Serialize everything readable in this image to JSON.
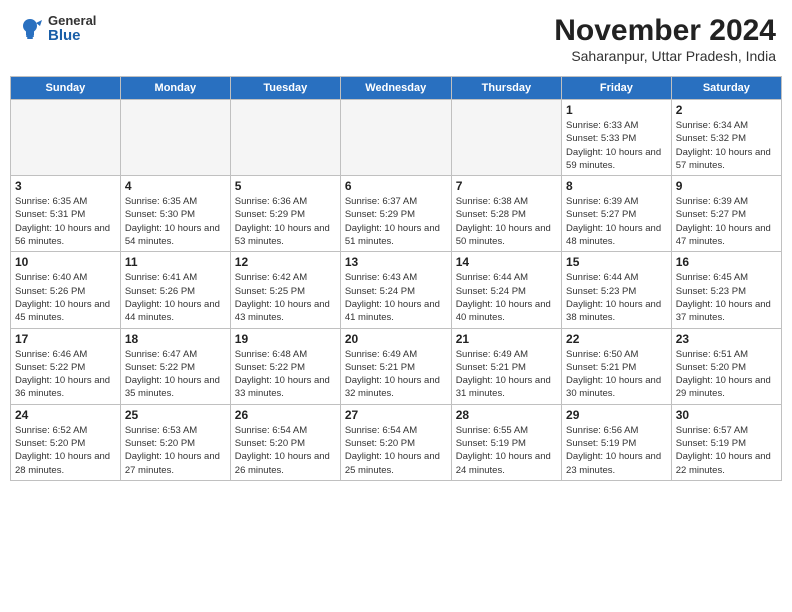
{
  "header": {
    "logo_general": "General",
    "logo_blue": "Blue",
    "month_title": "November 2024",
    "subtitle": "Saharanpur, Uttar Pradesh, India"
  },
  "weekdays": [
    "Sunday",
    "Monday",
    "Tuesday",
    "Wednesday",
    "Thursday",
    "Friday",
    "Saturday"
  ],
  "weeks": [
    [
      {
        "day": "",
        "info": ""
      },
      {
        "day": "",
        "info": ""
      },
      {
        "day": "",
        "info": ""
      },
      {
        "day": "",
        "info": ""
      },
      {
        "day": "",
        "info": ""
      },
      {
        "day": "1",
        "info": "Sunrise: 6:33 AM\nSunset: 5:33 PM\nDaylight: 10 hours and 59 minutes."
      },
      {
        "day": "2",
        "info": "Sunrise: 6:34 AM\nSunset: 5:32 PM\nDaylight: 10 hours and 57 minutes."
      }
    ],
    [
      {
        "day": "3",
        "info": "Sunrise: 6:35 AM\nSunset: 5:31 PM\nDaylight: 10 hours and 56 minutes."
      },
      {
        "day": "4",
        "info": "Sunrise: 6:35 AM\nSunset: 5:30 PM\nDaylight: 10 hours and 54 minutes."
      },
      {
        "day": "5",
        "info": "Sunrise: 6:36 AM\nSunset: 5:29 PM\nDaylight: 10 hours and 53 minutes."
      },
      {
        "day": "6",
        "info": "Sunrise: 6:37 AM\nSunset: 5:29 PM\nDaylight: 10 hours and 51 minutes."
      },
      {
        "day": "7",
        "info": "Sunrise: 6:38 AM\nSunset: 5:28 PM\nDaylight: 10 hours and 50 minutes."
      },
      {
        "day": "8",
        "info": "Sunrise: 6:39 AM\nSunset: 5:27 PM\nDaylight: 10 hours and 48 minutes."
      },
      {
        "day": "9",
        "info": "Sunrise: 6:39 AM\nSunset: 5:27 PM\nDaylight: 10 hours and 47 minutes."
      }
    ],
    [
      {
        "day": "10",
        "info": "Sunrise: 6:40 AM\nSunset: 5:26 PM\nDaylight: 10 hours and 45 minutes."
      },
      {
        "day": "11",
        "info": "Sunrise: 6:41 AM\nSunset: 5:26 PM\nDaylight: 10 hours and 44 minutes."
      },
      {
        "day": "12",
        "info": "Sunrise: 6:42 AM\nSunset: 5:25 PM\nDaylight: 10 hours and 43 minutes."
      },
      {
        "day": "13",
        "info": "Sunrise: 6:43 AM\nSunset: 5:24 PM\nDaylight: 10 hours and 41 minutes."
      },
      {
        "day": "14",
        "info": "Sunrise: 6:44 AM\nSunset: 5:24 PM\nDaylight: 10 hours and 40 minutes."
      },
      {
        "day": "15",
        "info": "Sunrise: 6:44 AM\nSunset: 5:23 PM\nDaylight: 10 hours and 38 minutes."
      },
      {
        "day": "16",
        "info": "Sunrise: 6:45 AM\nSunset: 5:23 PM\nDaylight: 10 hours and 37 minutes."
      }
    ],
    [
      {
        "day": "17",
        "info": "Sunrise: 6:46 AM\nSunset: 5:22 PM\nDaylight: 10 hours and 36 minutes."
      },
      {
        "day": "18",
        "info": "Sunrise: 6:47 AM\nSunset: 5:22 PM\nDaylight: 10 hours and 35 minutes."
      },
      {
        "day": "19",
        "info": "Sunrise: 6:48 AM\nSunset: 5:22 PM\nDaylight: 10 hours and 33 minutes."
      },
      {
        "day": "20",
        "info": "Sunrise: 6:49 AM\nSunset: 5:21 PM\nDaylight: 10 hours and 32 minutes."
      },
      {
        "day": "21",
        "info": "Sunrise: 6:49 AM\nSunset: 5:21 PM\nDaylight: 10 hours and 31 minutes."
      },
      {
        "day": "22",
        "info": "Sunrise: 6:50 AM\nSunset: 5:21 PM\nDaylight: 10 hours and 30 minutes."
      },
      {
        "day": "23",
        "info": "Sunrise: 6:51 AM\nSunset: 5:20 PM\nDaylight: 10 hours and 29 minutes."
      }
    ],
    [
      {
        "day": "24",
        "info": "Sunrise: 6:52 AM\nSunset: 5:20 PM\nDaylight: 10 hours and 28 minutes."
      },
      {
        "day": "25",
        "info": "Sunrise: 6:53 AM\nSunset: 5:20 PM\nDaylight: 10 hours and 27 minutes."
      },
      {
        "day": "26",
        "info": "Sunrise: 6:54 AM\nSunset: 5:20 PM\nDaylight: 10 hours and 26 minutes."
      },
      {
        "day": "27",
        "info": "Sunrise: 6:54 AM\nSunset: 5:20 PM\nDaylight: 10 hours and 25 minutes."
      },
      {
        "day": "28",
        "info": "Sunrise: 6:55 AM\nSunset: 5:19 PM\nDaylight: 10 hours and 24 minutes."
      },
      {
        "day": "29",
        "info": "Sunrise: 6:56 AM\nSunset: 5:19 PM\nDaylight: 10 hours and 23 minutes."
      },
      {
        "day": "30",
        "info": "Sunrise: 6:57 AM\nSunset: 5:19 PM\nDaylight: 10 hours and 22 minutes."
      }
    ]
  ]
}
